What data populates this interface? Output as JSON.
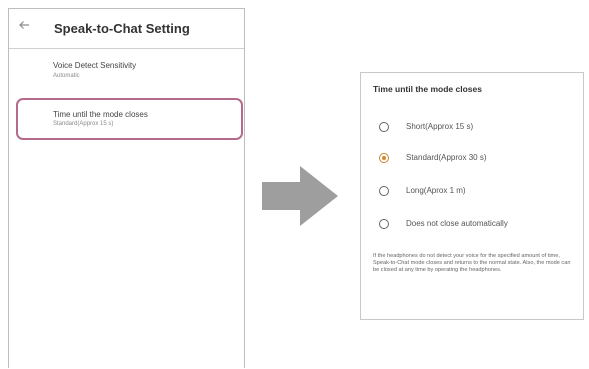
{
  "settings_screen": {
    "title": "Speak-to-Chat Setting",
    "items": [
      {
        "label": "Voice Detect Sensitivity",
        "value": "Automatic"
      },
      {
        "label": "Time until the mode closes",
        "value": "Standard(Approx 15 s)"
      }
    ]
  },
  "dialog": {
    "title": "Time until the mode closes",
    "options": [
      {
        "label": "Short(Approx 15 s)",
        "selected": false
      },
      {
        "label": "Standard(Approx 30 s)",
        "selected": true
      },
      {
        "label": "Long(Aprox 1 m)",
        "selected": false
      },
      {
        "label": "Does not close automatically",
        "selected": false
      }
    ],
    "note": "If the headphones do not detect your voice for the specified amount of time, Speak-to-Chat mode closes and returns to the normal state. Also, the mode can be closed at any time by operating the headphones."
  },
  "colors": {
    "highlight": "#b56a8c",
    "selected": "#d08a2e",
    "arrow": "#9e9e9e"
  },
  "icons": {
    "back": "back-arrow-icon",
    "transition": "right-arrow-icon"
  }
}
